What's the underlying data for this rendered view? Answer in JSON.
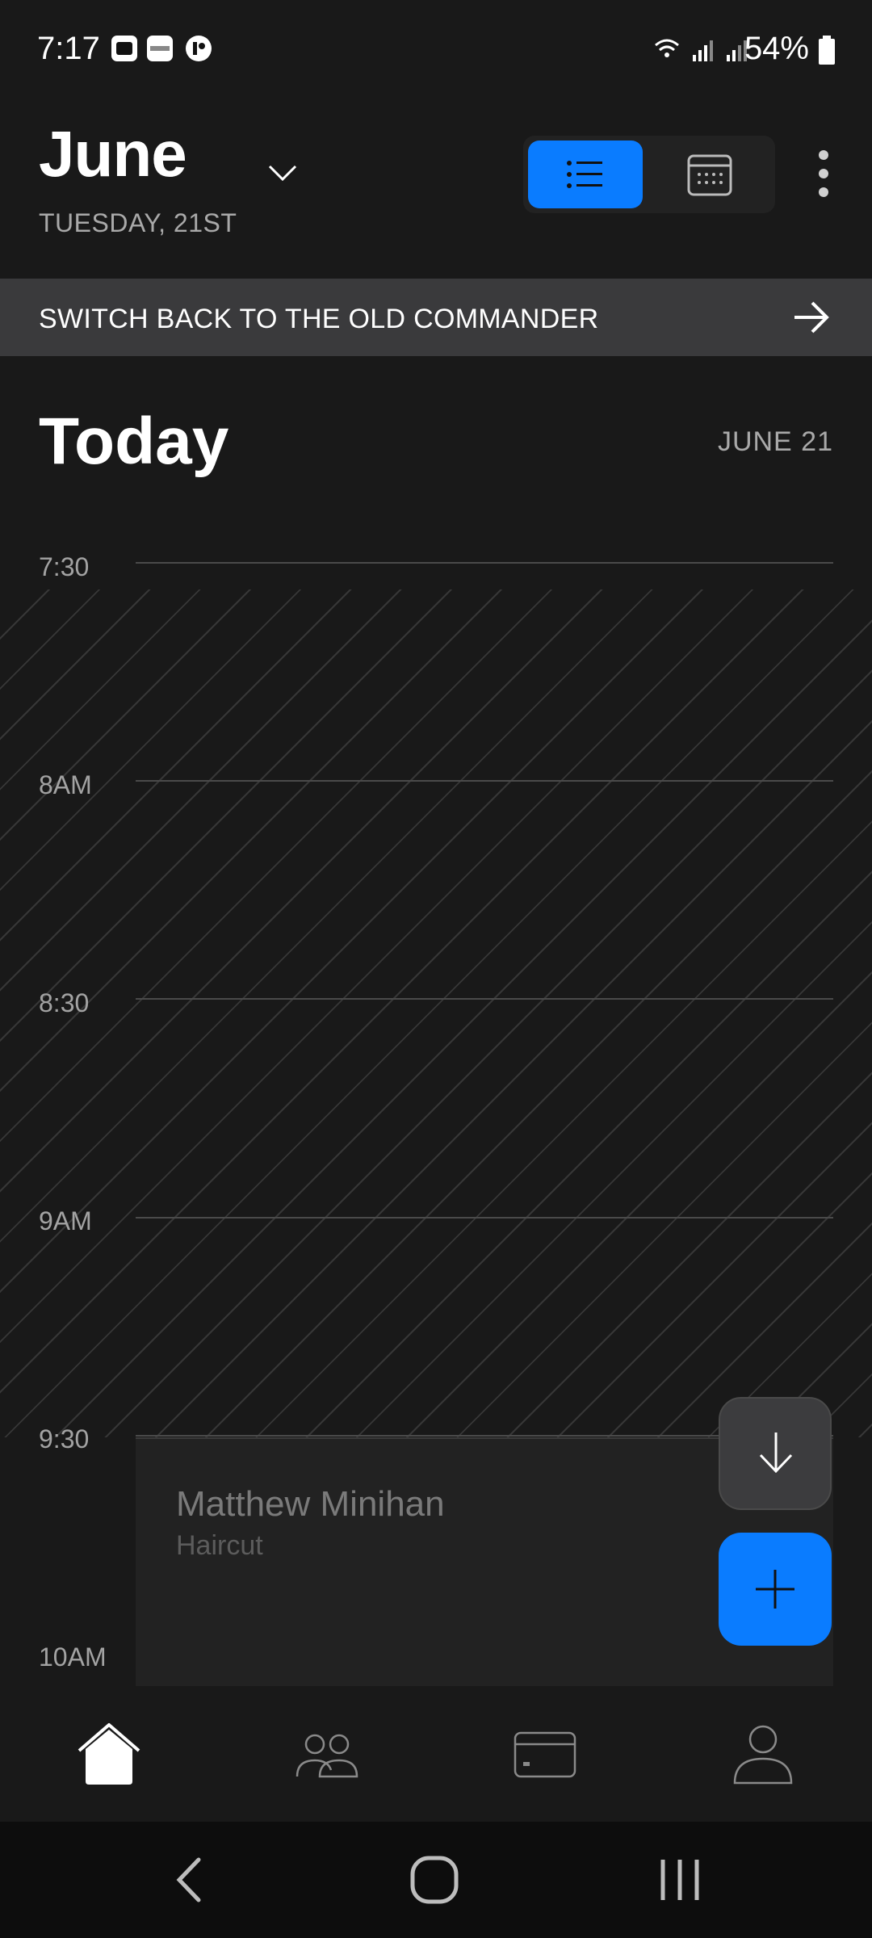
{
  "status_bar": {
    "time": "7:17",
    "battery": "54%",
    "notification_icons": [
      "app-icon-1",
      "cibc-icon",
      "app-icon-3"
    ],
    "system_icons": [
      "wifi-icon",
      "signal-icon",
      "signal-roaming-icon",
      "battery-icon"
    ]
  },
  "header": {
    "month": "June",
    "subdate": "TUESDAY, 21ST",
    "view_toggle": {
      "active": "list",
      "options": [
        "list-view-icon",
        "calendar-view-icon"
      ]
    },
    "accent_color": "#0a7cff"
  },
  "banner": {
    "text": "SWITCH BACK TO THE OLD COMMANDER"
  },
  "day": {
    "title": "Today",
    "date": "JUNE 21"
  },
  "timeline": {
    "slots": [
      "7:30",
      "8AM",
      "8:30",
      "9AM",
      "9:30",
      "10AM"
    ]
  },
  "appointment": {
    "client": "Matthew Minihan",
    "service": "Haircut"
  },
  "bottom_nav": {
    "items": [
      "home-icon",
      "clients-icon",
      "payments-icon",
      "profile-icon"
    ],
    "active": "home-icon"
  },
  "system_nav": [
    "back-icon",
    "home-circle-icon",
    "recents-icon"
  ]
}
